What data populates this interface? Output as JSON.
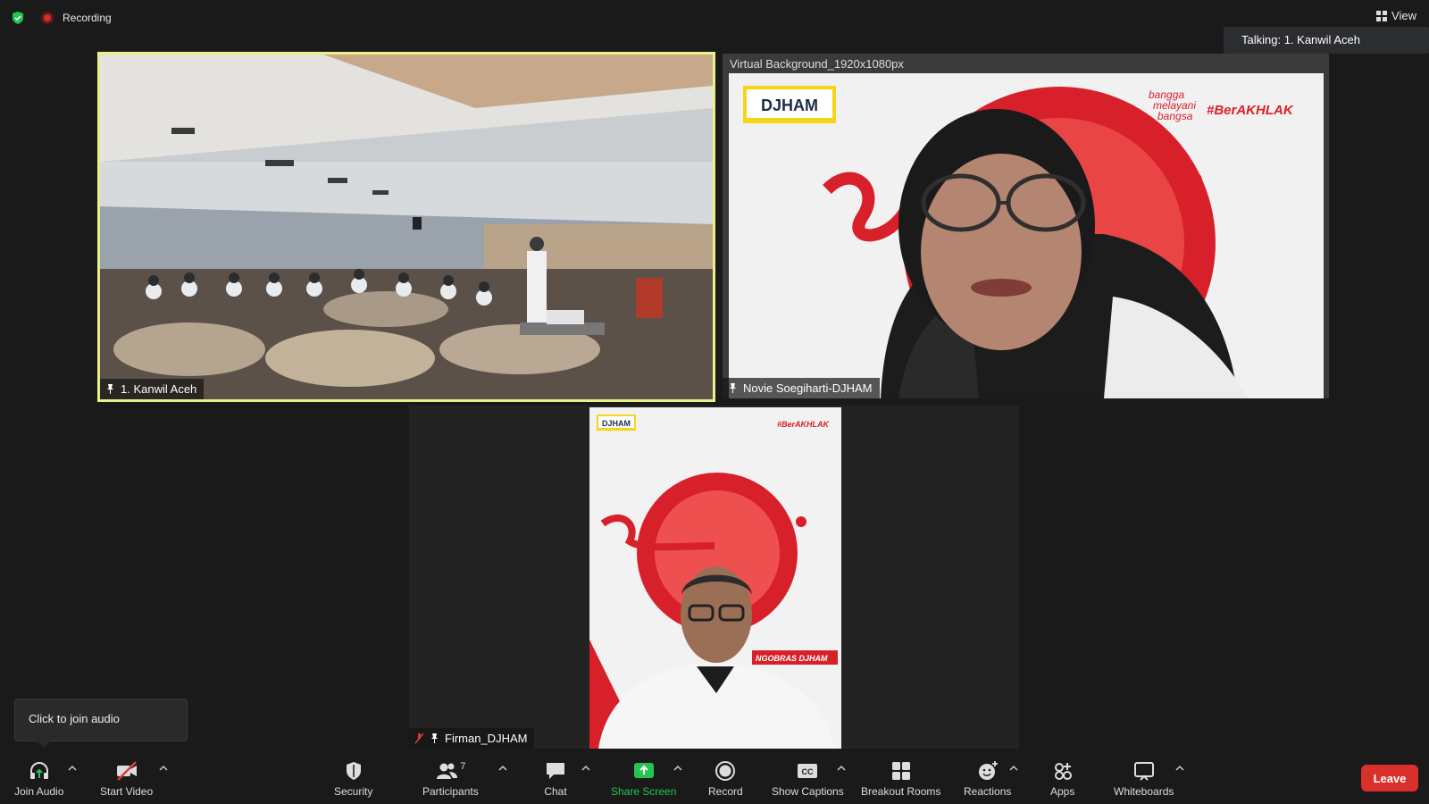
{
  "header": {
    "recording_label": "Recording",
    "view_label": "View",
    "talking_label": "Talking: 1. Kanwil Aceh"
  },
  "tiles": {
    "aceh": {
      "name": "1. Kanwil Aceh"
    },
    "novie": {
      "name": "Novie Soegiharti-DJHAM",
      "virtual_background_label": "Virtual Background_1920x1080px"
    },
    "firman": {
      "name": "Firman_DJHAM"
    }
  },
  "background_art": {
    "logo": "DJHAM",
    "tagline_1": "bangga",
    "tagline_2": "melayani",
    "tagline_3": "bangsa",
    "hashtag": "#BerAKHLAK",
    "ngobras": "NGOBRAS DJHAM"
  },
  "tooltip": {
    "text": "Click to join audio"
  },
  "toolbar": {
    "join_audio": "Join Audio",
    "start_video": "Start Video",
    "security": "Security",
    "participants": "Participants",
    "participants_count": "7",
    "chat": "Chat",
    "share_screen": "Share Screen",
    "record": "Record",
    "show_captions": "Show Captions",
    "breakout_rooms": "Breakout Rooms",
    "reactions": "Reactions",
    "apps": "Apps",
    "whiteboards": "Whiteboards",
    "leave": "Leave"
  },
  "colors": {
    "active_speaker_border": "#e9f08a",
    "share_green": "#23c552",
    "leave_red": "#d9302c",
    "brand_red": "#d8202a"
  }
}
